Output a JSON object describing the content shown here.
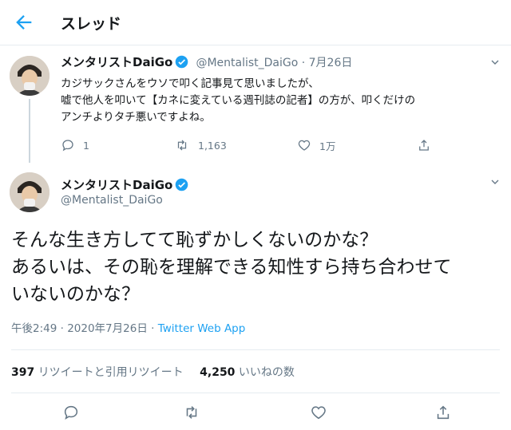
{
  "header": {
    "title": "スレッド"
  },
  "tweet1": {
    "name": "メンタリストDaiGo",
    "handle_date": "@Mentalist_DaiGo · 7月26日",
    "lines": [
      "カジサックさんをウソで叩く記事見て思いましたが、",
      "嘘で他人を叩いて【カネに変えている週刊誌の記者】の方が、叩くだけの",
      "アンチよりタチ悪いですよね。"
    ],
    "reply_count": "1",
    "retweet_count": "1,163",
    "like_count": "1万"
  },
  "tweet2": {
    "name": "メンタリストDaiGo",
    "handle": "@Mentalist_DaiGo",
    "lines": [
      "そんな生き方してて恥ずかしくないのかな？",
      "あるいは、その恥を理解できる知性すら持ち合わせて",
      "いないのかな？"
    ],
    "time": "午後2:49 · 2020年7月26日 · ",
    "app": "Twitter Web App",
    "rt_count": "397",
    "rt_label": "リツイートと引用リツイート",
    "like_count": "4,250",
    "like_label": "いいねの数"
  },
  "colors": {
    "accent": "#1da1f2",
    "muted": "#657786",
    "text": "#14171a"
  }
}
